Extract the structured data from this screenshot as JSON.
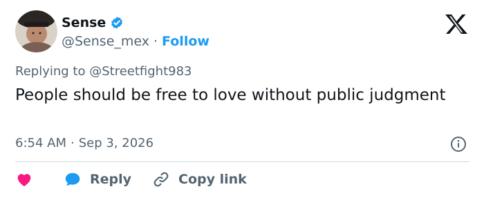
{
  "author": {
    "display_name": "Sense",
    "handle": "@Sense_mex",
    "separator": "·",
    "follow_label": "Follow"
  },
  "reply_context": {
    "prefix": "Replying to",
    "mention": "@Streetfight983"
  },
  "tweet": {
    "text": "People should be free to love without public judgment",
    "time": "6:54 AM",
    "separator": "·",
    "date": "Sep 3, 2026"
  },
  "actions": {
    "reply_label": "Reply",
    "copy_link_label": "Copy link"
  },
  "colors": {
    "accent": "#1d9bf0",
    "like": "#f91880",
    "text_secondary": "#536471",
    "divider": "#cfd9de"
  },
  "icons": {
    "verified": "verified-badge-icon",
    "logo": "x-logo-icon",
    "info": "info-icon",
    "like": "heart-icon",
    "reply": "speech-bubble-icon",
    "copy_link": "link-icon"
  }
}
